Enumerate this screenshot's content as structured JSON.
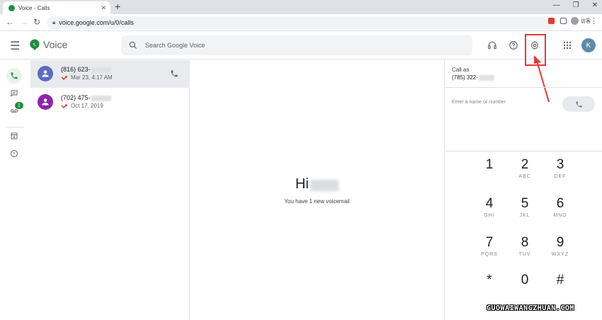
{
  "browser": {
    "tab_title": "Voice - Calls",
    "tab_close": "✕",
    "new_tab": "+",
    "url": "voice.google.com/u/0/calls",
    "profile_label": "访客",
    "window_controls": [
      "—",
      "❐",
      "✕"
    ]
  },
  "header": {
    "app_name": "Voice",
    "search_placeholder": "Search Google Voice",
    "avatar_letter": "K",
    "icons": [
      "menu-icon",
      "headset-icon",
      "help-icon",
      "settings-icon",
      "apps-grid-icon"
    ]
  },
  "rail": {
    "voicemail_badge": "1",
    "icons": [
      "phone-icon",
      "message-icon",
      "voicemail-icon",
      "archive-icon",
      "info-icon"
    ]
  },
  "calls": [
    {
      "number": "(816) 623-",
      "date": "Mar 23, 4:17 AM",
      "avatar_color": "#5c6bc0",
      "selected": true
    },
    {
      "number": "(702) 475-",
      "date": "Oct 17, 2019",
      "avatar_color": "#8e24aa",
      "selected": false
    }
  ],
  "center": {
    "greeting": "Hi",
    "voicemail_message": "You have 1 new voicemail"
  },
  "dialer": {
    "call_as_label": "Call as",
    "call_as_number": "(785) 322-",
    "input_placeholder": "Enter a name or number",
    "keys": [
      {
        "digit": "1",
        "letters": ""
      },
      {
        "digit": "2",
        "letters": "ABC"
      },
      {
        "digit": "3",
        "letters": "DEF"
      },
      {
        "digit": "4",
        "letters": "GHI"
      },
      {
        "digit": "5",
        "letters": "JKL"
      },
      {
        "digit": "6",
        "letters": "MNO"
      },
      {
        "digit": "7",
        "letters": "PQRS"
      },
      {
        "digit": "8",
        "letters": "TUV"
      },
      {
        "digit": "9",
        "letters": "WXYZ"
      },
      {
        "digit": "*",
        "letters": ""
      },
      {
        "digit": "0",
        "letters": ""
      },
      {
        "digit": "#",
        "letters": ""
      }
    ]
  },
  "colors": {
    "accent_green": "#1e8e3e",
    "highlight_red": "#e53935"
  },
  "watermark": "GUOWAIWANGZHUAN.COM"
}
